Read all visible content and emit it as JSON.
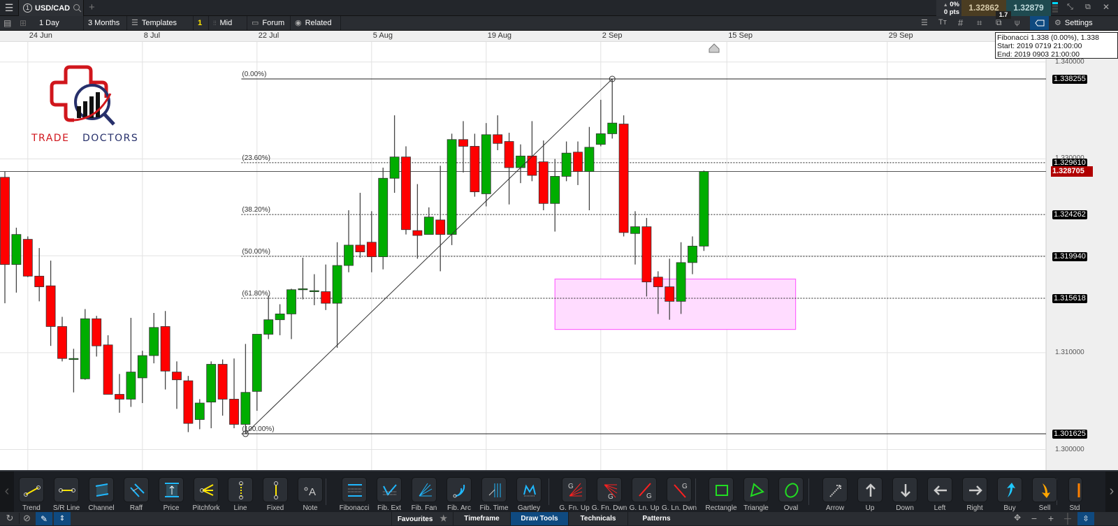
{
  "topbar": {
    "instrument_tab": {
      "number": "1",
      "symbol": "USD/CAD"
    },
    "add_tab": "+",
    "change_pct": "0%",
    "change_pts": "0 pts",
    "sell_price": "1.32862",
    "buy_price": "1.32879",
    "spread": "1.7",
    "colors": {
      "sell_bg": "#4b3d22",
      "buy_bg": "#1f4a50"
    }
  },
  "toolbar": {
    "interval": "1 Day",
    "range": "3 Months",
    "templates": "Templates",
    "badge": "1",
    "price_type": "Mid",
    "forum": "Forum",
    "related": "Related",
    "settings": "Settings"
  },
  "tooltip": {
    "line1": "Fibonacci 1.338 (0.00%), 1.338",
    "line2": "Start: 2019 0719 21:00:00",
    "line3": "End: 2019 0903 21:00:00"
  },
  "logo": {
    "word1": "TRADE",
    "word2": "DOCTORS",
    "colors": {
      "red": "#d0161c",
      "navy": "#27306b"
    }
  },
  "chart_data": {
    "type": "candlestick",
    "symbol": "USD/CAD",
    "colors": {
      "up": "#00ad00",
      "down": "#ff0000",
      "current": "#b00000",
      "zone": "#ff66ff"
    },
    "ylim": [
      1.2965,
      1.3415
    ],
    "y_ticks": [
      "1.340000",
      "1.330000",
      "1.320000",
      "1.310000",
      "1.300000"
    ],
    "x_ticks": [
      {
        "label": "24 Jun",
        "date": "2019-06-24"
      },
      {
        "label": "8 Jul",
        "date": "2019-07-08"
      },
      {
        "label": "22 Jul",
        "date": "2019-07-22"
      },
      {
        "label": "5 Aug",
        "date": "2019-08-05"
      },
      {
        "label": "19 Aug",
        "date": "2019-08-19"
      },
      {
        "label": "2 Sep",
        "date": "2019-09-02"
      },
      {
        "label": "15 Sep",
        "date": "2019-09-15"
      },
      {
        "label": "29 Sep",
        "date": "2019-09-29"
      }
    ],
    "candles_fields": [
      "date",
      "open",
      "high",
      "low",
      "close"
    ],
    "candles": [
      [
        "2019-06-20",
        1.3281,
        1.3287,
        1.3151,
        1.3191
      ],
      [
        "2019-06-21",
        1.3191,
        1.3229,
        1.3162,
        1.3222
      ],
      [
        "2019-06-24",
        1.3217,
        1.322,
        1.3178,
        1.3179
      ],
      [
        "2019-06-25",
        1.3179,
        1.3208,
        1.3153,
        1.3168
      ],
      [
        "2019-06-26",
        1.3169,
        1.3195,
        1.3107,
        1.3127
      ],
      [
        "2019-06-27",
        1.3127,
        1.3137,
        1.3091,
        1.3094
      ],
      [
        "2019-06-28",
        1.3094,
        1.3104,
        1.3059,
        1.3094
      ],
      [
        "2019-07-01",
        1.3073,
        1.3145,
        1.3072,
        1.3135
      ],
      [
        "2019-07-02",
        1.3135,
        1.3138,
        1.3096,
        1.3107
      ],
      [
        "2019-07-03",
        1.3108,
        1.3118,
        1.3057,
        1.3057
      ],
      [
        "2019-07-04",
        1.3057,
        1.3078,
        1.3038,
        1.3052
      ],
      [
        "2019-07-05",
        1.3052,
        1.3136,
        1.3044,
        1.308
      ],
      [
        "2019-07-08",
        1.3074,
        1.3102,
        1.3048,
        1.3097
      ],
      [
        "2019-07-09",
        1.3097,
        1.3141,
        1.3089,
        1.3126
      ],
      [
        "2019-07-10",
        1.3127,
        1.3143,
        1.3062,
        1.3081
      ],
      [
        "2019-07-11",
        1.308,
        1.3091,
        1.3042,
        1.3072
      ],
      [
        "2019-07-12",
        1.3071,
        1.3076,
        1.3018,
        1.3027
      ],
      [
        "2019-07-15",
        1.3031,
        1.3052,
        1.3021,
        1.3048
      ],
      [
        "2019-07-16",
        1.3049,
        1.3091,
        1.3022,
        1.3088
      ],
      [
        "2019-07-17",
        1.3088,
        1.3093,
        1.3035,
        1.3052
      ],
      [
        "2019-07-18",
        1.3052,
        1.3094,
        1.3022,
        1.3026
      ],
      [
        "2019-07-19",
        1.3026,
        1.3109,
        1.3016,
        1.3059
      ],
      [
        "2019-07-22",
        1.306,
        1.3119,
        1.304,
        1.3119
      ],
      [
        "2019-07-23",
        1.3119,
        1.3159,
        1.3114,
        1.3134
      ],
      [
        "2019-07-24",
        1.3134,
        1.315,
        1.3118,
        1.314
      ],
      [
        "2019-07-25",
        1.314,
        1.3166,
        1.3114,
        1.3165
      ],
      [
        "2019-07-26",
        1.3166,
        1.3198,
        1.3155,
        1.3166
      ],
      [
        "2019-07-29",
        1.3164,
        1.3181,
        1.3149,
        1.3164
      ],
      [
        "2019-07-30",
        1.3163,
        1.3191,
        1.3144,
        1.3151
      ],
      [
        "2019-07-31",
        1.3151,
        1.3214,
        1.3105,
        1.319
      ],
      [
        "2019-08-01",
        1.319,
        1.3247,
        1.3183,
        1.3211
      ],
      [
        "2019-08-02",
        1.3211,
        1.3265,
        1.3198,
        1.3204
      ],
      [
        "2019-08-05",
        1.3214,
        1.3246,
        1.3183,
        1.3199
      ],
      [
        "2019-08-06",
        1.3199,
        1.3291,
        1.3186,
        1.328
      ],
      [
        "2019-08-07",
        1.328,
        1.3345,
        1.3265,
        1.3302
      ],
      [
        "2019-08-08",
        1.3302,
        1.3313,
        1.3222,
        1.3227
      ],
      [
        "2019-08-09",
        1.3226,
        1.3274,
        1.3197,
        1.3221
      ],
      [
        "2019-08-12",
        1.3222,
        1.325,
        1.3222,
        1.324
      ],
      [
        "2019-08-13",
        1.3237,
        1.3293,
        1.3184,
        1.3222
      ],
      [
        "2019-08-14",
        1.3222,
        1.3326,
        1.3211,
        1.332
      ],
      [
        "2019-08-15",
        1.332,
        1.3339,
        1.3286,
        1.3313
      ],
      [
        "2019-08-16",
        1.3313,
        1.3326,
        1.3261,
        1.3266
      ],
      [
        "2019-08-19",
        1.3264,
        1.3337,
        1.3251,
        1.3325
      ],
      [
        "2019-08-20",
        1.3325,
        1.3345,
        1.3309,
        1.3316
      ],
      [
        "2019-08-21",
        1.3318,
        1.3327,
        1.3253,
        1.3291
      ],
      [
        "2019-08-22",
        1.3291,
        1.3315,
        1.3275,
        1.3303
      ],
      [
        "2019-08-23",
        1.3303,
        1.3339,
        1.3277,
        1.3283
      ],
      [
        "2019-08-26",
        1.3297,
        1.3319,
        1.3247,
        1.3254
      ],
      [
        "2019-08-27",
        1.3254,
        1.33,
        1.3225,
        1.3282
      ],
      [
        "2019-08-28",
        1.3282,
        1.3318,
        1.3277,
        1.3306
      ],
      [
        "2019-08-29",
        1.3307,
        1.3318,
        1.3273,
        1.3287
      ],
      [
        "2019-08-30",
        1.3287,
        1.3333,
        1.3247,
        1.3312
      ],
      [
        "2019-09-02",
        1.3315,
        1.3361,
        1.3313,
        1.3326
      ],
      [
        "2019-09-03",
        1.3326,
        1.338255,
        1.3321,
        1.3337
      ],
      [
        "2019-09-04",
        1.3336,
        1.3345,
        1.322,
        1.3224
      ],
      [
        "2019-09-05",
        1.3223,
        1.3246,
        1.3191,
        1.323
      ],
      [
        "2019-09-06",
        1.323,
        1.3239,
        1.3158,
        1.3173
      ],
      [
        "2019-09-09",
        1.3178,
        1.3184,
        1.314,
        1.3168
      ],
      [
        "2019-09-10",
        1.3168,
        1.3197,
        1.3134,
        1.3153
      ],
      [
        "2019-09-11",
        1.3153,
        1.3214,
        1.314,
        1.3193
      ],
      [
        "2019-09-12",
        1.3193,
        1.322,
        1.3181,
        1.321
      ],
      [
        "2019-09-13",
        1.321,
        1.3288,
        1.3205,
        1.328705
      ]
    ],
    "current_price": "1.328705",
    "fibonacci": {
      "start": {
        "date": "2019-07-19",
        "price": 1.301625
      },
      "end": {
        "date": "2019-09-03",
        "price": 1.338255
      },
      "levels": [
        {
          "label": "(0.00%)",
          "price": "1.338255",
          "style": "solid"
        },
        {
          "label": "(23.60%)",
          "price": "1.329610",
          "style": "dotted"
        },
        {
          "label": "(38.20%)",
          "price": "1.324262",
          "style": "dotted"
        },
        {
          "label": "(50.00%)",
          "price": "1.319940",
          "style": "dotted"
        },
        {
          "label": "(61.80%)",
          "price": "1.315618",
          "style": "dotted"
        },
        {
          "label": "(100.00%)",
          "price": "1.301625",
          "style": "solid"
        }
      ]
    },
    "zone_rectangle": {
      "start_date": "2019-08-27",
      "end_date": "2019-09-21",
      "top": 1.3176,
      "bottom": 1.3124
    }
  },
  "draw_tools": [
    {
      "label": "Trend",
      "icon": "trend-line-icon"
    },
    {
      "label": "S/R Line",
      "icon": "sr-line-icon"
    },
    {
      "label": "Channel",
      "icon": "channel-icon"
    },
    {
      "label": "Raff",
      "icon": "raff-icon"
    },
    {
      "label": "Price",
      "icon": "price-icon"
    },
    {
      "label": "Pitchfork",
      "icon": "pitchfork-icon"
    },
    {
      "label": "Line",
      "icon": "vertical-line-icon"
    },
    {
      "label": "Fixed",
      "icon": "fixed-line-icon"
    },
    {
      "label": "Note",
      "icon": "note-icon"
    },
    {
      "label": "Fibonacci",
      "icon": "fibonacci-icon"
    },
    {
      "label": "Fib. Ext",
      "icon": "fib-ext-icon"
    },
    {
      "label": "Fib. Fan",
      "icon": "fib-fan-icon"
    },
    {
      "label": "Fib. Arc",
      "icon": "fib-arc-icon"
    },
    {
      "label": "Fib. Time",
      "icon": "fib-time-icon"
    },
    {
      "label": "Gartley",
      "icon": "gartley-icon"
    },
    {
      "label": "G. Fn. Up",
      "icon": "gann-fan-up-icon"
    },
    {
      "label": "G. Fn. Dwn",
      "icon": "gann-fan-down-icon"
    },
    {
      "label": "G. Ln. Up",
      "icon": "gann-line-up-icon"
    },
    {
      "label": "G. Ln. Dwn",
      "icon": "gann-line-down-icon"
    },
    {
      "label": "Rectangle",
      "icon": "rectangle-icon"
    },
    {
      "label": "Triangle",
      "icon": "triangle-icon"
    },
    {
      "label": "Oval",
      "icon": "oval-icon"
    },
    {
      "label": "Arrow",
      "icon": "arrow-icon"
    },
    {
      "label": "Up",
      "icon": "arrow-up-icon"
    },
    {
      "label": "Down",
      "icon": "arrow-down-icon"
    },
    {
      "label": "Left",
      "icon": "arrow-left-icon"
    },
    {
      "label": "Right",
      "icon": "arrow-right-icon"
    },
    {
      "label": "Buy",
      "icon": "buy-arrow-icon"
    },
    {
      "label": "Sell",
      "icon": "sell-arrow-icon"
    },
    {
      "label": "Std",
      "icon": "std-icon"
    }
  ],
  "bottom_tabs": [
    {
      "label": "Favourites",
      "active": false
    },
    {
      "label": "Timeframe",
      "active": false
    },
    {
      "label": "Draw Tools",
      "active": true
    },
    {
      "label": "Technicals",
      "active": false
    },
    {
      "label": "Patterns",
      "active": false
    }
  ],
  "favourites_star": "★"
}
